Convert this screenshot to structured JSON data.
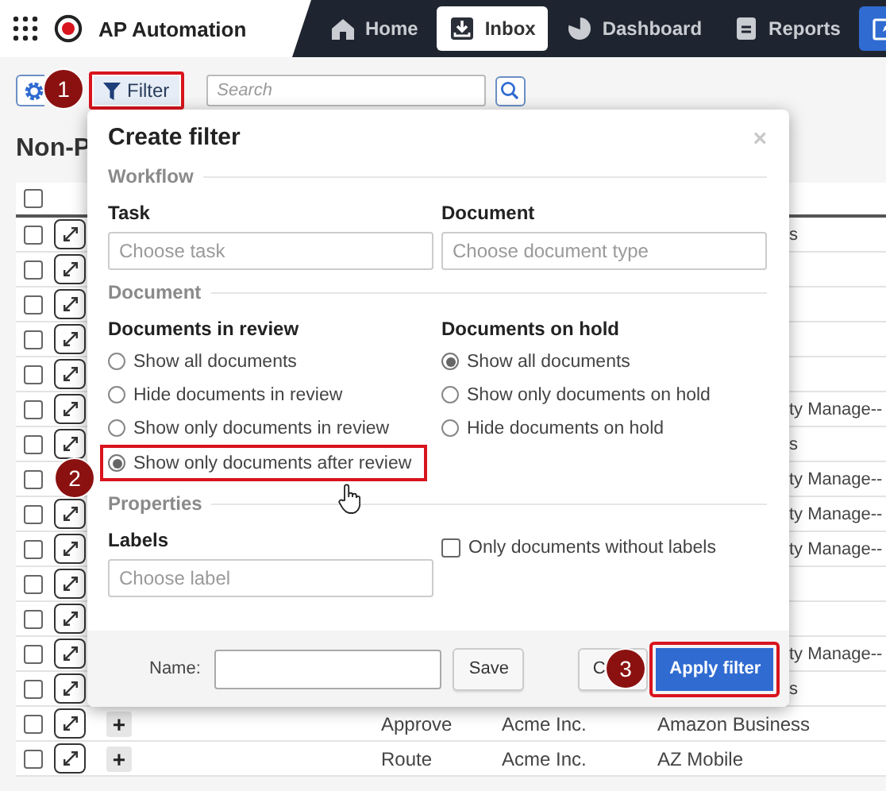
{
  "header": {
    "app_title": "AP Automation",
    "nav": [
      {
        "label": "Home",
        "selected": false
      },
      {
        "label": "Inbox",
        "selected": true
      },
      {
        "label": "Dashboard",
        "selected": false
      },
      {
        "label": "Reports",
        "selected": false
      }
    ]
  },
  "toolbar": {
    "filter_button": {
      "label": "Filter",
      "highlighted": true
    },
    "search": {
      "placeholder": "Search"
    }
  },
  "page_title": "Non-P",
  "table": {
    "header_checkbox": {
      "checked": false
    },
    "rows": [
      {
        "kind": "covered",
        "checked": false,
        "vendor": "s"
      },
      {
        "kind": "covered",
        "checked": false
      },
      {
        "kind": "covered",
        "checked": false
      },
      {
        "kind": "covered",
        "checked": false
      },
      {
        "kind": "covered",
        "checked": false
      },
      {
        "kind": "covered",
        "checked": false,
        "vendor": "ty Manage--"
      },
      {
        "kind": "covered",
        "checked": false,
        "vendor": "s"
      },
      {
        "kind": "badged",
        "checked": false,
        "vendor": "ty Manage--"
      },
      {
        "kind": "covered",
        "checked": false,
        "vendor": "ty Manage--"
      },
      {
        "kind": "covered",
        "checked": false,
        "vendor": "ty Manage--"
      },
      {
        "kind": "covered",
        "checked": false
      },
      {
        "kind": "covered",
        "checked": false
      },
      {
        "kind": "covered",
        "checked": false,
        "vendor": "ty Manage--"
      },
      {
        "kind": "covered",
        "checked": false,
        "vendor": "s"
      },
      {
        "kind": "full",
        "checked": false,
        "add": "+",
        "task": "Approve",
        "company": "Acme Inc.",
        "vendor": "Amazon Business"
      },
      {
        "kind": "full",
        "checked": false,
        "add": "+",
        "task": "Route",
        "company": "Acme Inc.",
        "vendor": "AZ Mobile"
      }
    ]
  },
  "dialog": {
    "title": "Create filter",
    "close": "×",
    "workflow": {
      "legend": "Workflow",
      "fields": [
        {
          "label": "Task",
          "placeholder": "Choose task"
        },
        {
          "label": "Document",
          "placeholder": "Choose document type"
        }
      ]
    },
    "document": {
      "legend": "Document",
      "groups": [
        {
          "label": "Documents in review",
          "options": [
            {
              "label": "Show all documents",
              "selected": false,
              "highlighted": false
            },
            {
              "label": "Hide documents in review",
              "selected": false,
              "highlighted": false
            },
            {
              "label": "Show only documents in review",
              "selected": false,
              "highlighted": false
            },
            {
              "label": "Show only documents after review",
              "selected": true,
              "highlighted": true
            }
          ]
        },
        {
          "label": "Documents on hold",
          "options": [
            {
              "label": "Show all documents",
              "selected": true,
              "highlighted": false
            },
            {
              "label": "Show only documents on hold",
              "selected": false,
              "highlighted": false
            },
            {
              "label": "Hide documents on hold",
              "selected": false,
              "highlighted": false
            }
          ]
        }
      ]
    },
    "properties": {
      "legend": "Properties",
      "labels": {
        "label": "Labels",
        "placeholder": "Choose label"
      },
      "without_labels": {
        "label": "Only documents without labels",
        "checked": false
      }
    },
    "footer": {
      "name_label": "Name:",
      "save": "Save",
      "cancel": "C",
      "apply": {
        "label": "Apply filter",
        "highlighted": true
      }
    }
  },
  "callouts": [
    "1",
    "2",
    "3"
  ]
}
